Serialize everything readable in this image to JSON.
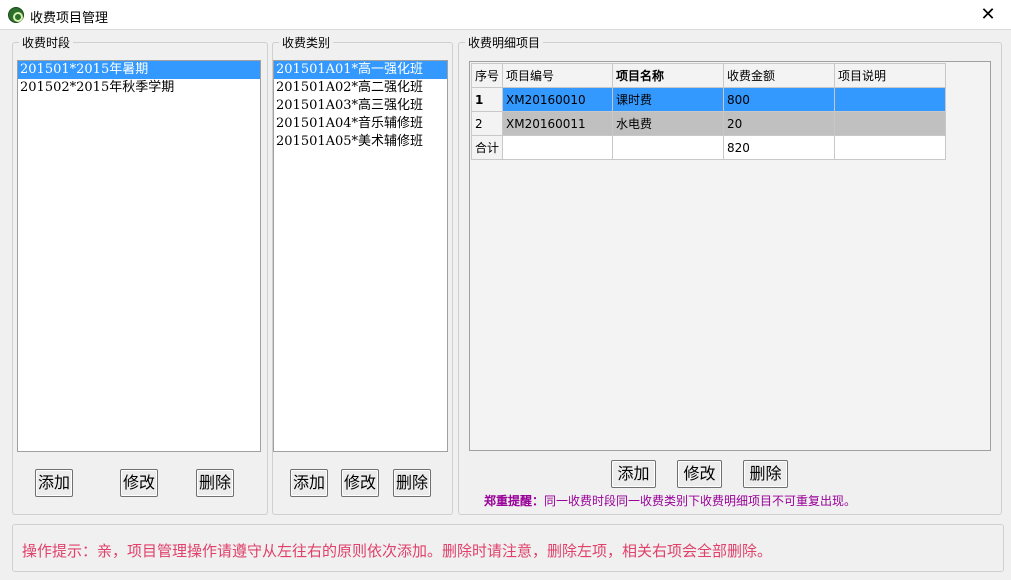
{
  "window": {
    "title": "收费项目管理",
    "close_glyph": "✕"
  },
  "periods": {
    "legend": "收费时段",
    "items": [
      "201501*2015年暑期",
      "201502*2015年秋季学期"
    ],
    "selected_index": 0,
    "buttons": {
      "add": "添加",
      "edit": "修改",
      "delete": "删除"
    }
  },
  "categories": {
    "legend": "收费类别",
    "items": [
      "201501A01*高一强化班",
      "201501A02*高二强化班",
      "201501A03*高三强化班",
      "201501A04*音乐辅修班",
      "201501A05*美术辅修班"
    ],
    "selected_index": 0,
    "buttons": {
      "add": "添加",
      "edit": "修改",
      "delete": "删除"
    }
  },
  "details": {
    "legend": "收费明细项目",
    "columns": [
      "序号",
      "项目编号",
      "项目名称",
      "收费金额",
      "项目说明"
    ],
    "rows": [
      {
        "no": "1",
        "code": "XM20160010",
        "name": "课时费",
        "amount": "800",
        "note": ""
      },
      {
        "no": "2",
        "code": "XM20160011",
        "name": "水电费",
        "amount": "20",
        "note": ""
      }
    ],
    "total": {
      "label": "合计",
      "amount": "820"
    },
    "buttons": {
      "add": "添加",
      "edit": "修改",
      "delete": "删除"
    },
    "reminder_prefix": "郑重提醒：",
    "reminder_text": "同一收费时段同一收费类别下收费明细项目不可重复出现。"
  },
  "tip": {
    "text": "操作提示：亲，项目管理操作请遵守从左往右的原则依次添加。删除时请注意，删除左项，相关右项会全部删除。"
  },
  "colors": {
    "selection": "#3399ff",
    "reminder": "#990099",
    "tip": "#e0406a",
    "row_gray": "#c0c0c0"
  }
}
